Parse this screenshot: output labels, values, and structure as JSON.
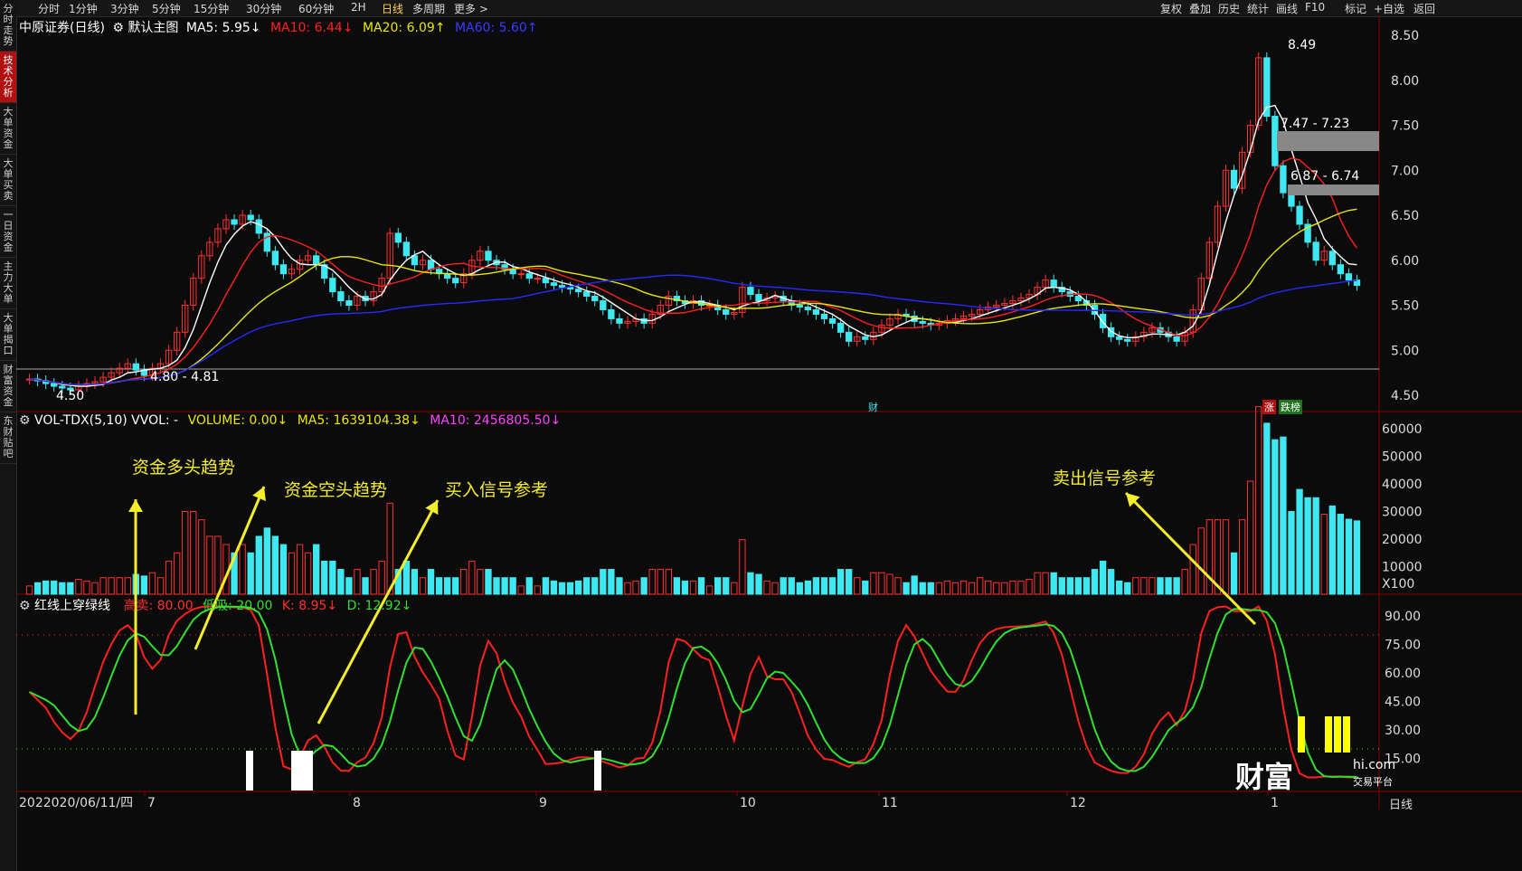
{
  "top_toolbar": {
    "periods": [
      "分时",
      "1分钟",
      "3分钟",
      "5分钟",
      "15分钟",
      "30分钟",
      "60分钟",
      "2H",
      "日线",
      "多周期",
      "更多 >"
    ],
    "active_period": "日线",
    "tools": [
      "复权",
      "叠加",
      "历史",
      "统计",
      "画线",
      "F10",
      "标记",
      "+自选",
      "返回"
    ]
  },
  "left_tabs": [
    "分时走势",
    "技术分析",
    "大单资金",
    "大单买卖",
    "一日资金",
    "主力大单",
    "大单揭口",
    "财富资金",
    "东财贴吧"
  ],
  "left_tab_active": 1,
  "price_panel": {
    "title": "中原证券(日线)",
    "main_chart_label": "默认主图",
    "ma5": "MA5: 5.95↓",
    "ma10": "MA10: 6.44↓",
    "ma20": "MA20: 6.09↑",
    "ma60": "MA60: 5.60↑",
    "colors": {
      "ma5": "#ffffff",
      "ma10": "#ff2020",
      "ma20": "#e8e800",
      "ma60": "#2828ff",
      "up": "#ff3030",
      "down": "#3ee8f0"
    },
    "y_ticks": [
      "8.50",
      "8.00",
      "7.50",
      "7.00",
      "6.50",
      "6.00",
      "5.50",
      "5.00",
      "4.50"
    ],
    "annotations": {
      "high": "8.49",
      "low": "4.50",
      "gap1": "7.47 - 7.23",
      "gap2": "6.87 - 6.74",
      "gap3": "4.80 - 4.81"
    },
    "markers": [
      "财",
      "涨",
      "跌榜"
    ]
  },
  "volume_panel": {
    "title": "VOL-TDX(5,10) VVOL: -",
    "volume": "VOLUME: 0.00↓",
    "ma5": "MA5: 1639104.38↓",
    "ma10": "MA10: 2456805.50↓",
    "y_ticks": [
      "60000",
      "50000",
      "40000",
      "30000",
      "20000",
      "10000",
      "X100"
    ]
  },
  "indicator_panel": {
    "title": "红线上穿绿线",
    "high_sell": "高卖: 80.00",
    "low_buy": "低吸: 20.00",
    "k": "K: 8.95↓",
    "d": "D: 12.92↓",
    "y_ticks": [
      "90.00",
      "75.00",
      "60.00",
      "45.00",
      "30.00",
      "15.00"
    ]
  },
  "x_axis": {
    "date_label": "2022020/06/11/四",
    "months": [
      "7",
      "8",
      "9",
      "10",
      "11",
      "12",
      "1"
    ],
    "period_label": "日线"
  },
  "callouts": [
    "资金多头趋势",
    "资金空头趋势",
    "买入信号参考",
    "卖出信号参考"
  ],
  "watermark": {
    "logo": "财富",
    "site": "hi.com",
    "sub": "交易平台"
  },
  "chart_data": {
    "type": "candlestick",
    "price_range": [
      4.45,
      8.55
    ],
    "closes": [
      4.68,
      4.66,
      4.63,
      4.6,
      4.58,
      4.56,
      4.6,
      4.63,
      4.65,
      4.7,
      4.75,
      4.8,
      4.85,
      4.78,
      4.72,
      4.8,
      4.85,
      5.0,
      5.2,
      5.5,
      5.8,
      6.05,
      6.2,
      6.35,
      6.45,
      6.4,
      6.5,
      6.45,
      6.3,
      6.1,
      5.95,
      5.85,
      5.9,
      6.0,
      6.05,
      5.95,
      5.8,
      5.65,
      5.55,
      5.5,
      5.6,
      5.55,
      5.65,
      5.8,
      6.3,
      6.2,
      6.05,
      5.95,
      6.0,
      5.9,
      5.85,
      5.8,
      5.75,
      5.85,
      6.0,
      6.1,
      6.0,
      5.95,
      5.9,
      5.85,
      5.85,
      5.8,
      5.8,
      5.75,
      5.72,
      5.7,
      5.68,
      5.65,
      5.6,
      5.55,
      5.45,
      5.35,
      5.3,
      5.32,
      5.35,
      5.3,
      5.4,
      5.5,
      5.6,
      5.55,
      5.52,
      5.55,
      5.5,
      5.5,
      5.45,
      5.4,
      5.42,
      5.7,
      5.62,
      5.55,
      5.58,
      5.6,
      5.55,
      5.5,
      5.48,
      5.45,
      5.4,
      5.35,
      5.3,
      5.2,
      5.1,
      5.15,
      5.12,
      5.2,
      5.28,
      5.35,
      5.4,
      5.38,
      5.32,
      5.3,
      5.28,
      5.3,
      5.33,
      5.35,
      5.38,
      5.4,
      5.45,
      5.48,
      5.5,
      5.52,
      5.55,
      5.58,
      5.62,
      5.7,
      5.78,
      5.7,
      5.65,
      5.6,
      5.55,
      5.5,
      5.4,
      5.25,
      5.15,
      5.12,
      5.1,
      5.15,
      5.2,
      5.25,
      5.2,
      5.15,
      5.1,
      5.2,
      5.45,
      5.8,
      6.2,
      6.6,
      7.0,
      6.8,
      7.2,
      7.5,
      8.25,
      7.6,
      7.05,
      6.75,
      6.6,
      6.4,
      6.2,
      6.0,
      6.1,
      5.95,
      5.85,
      5.78,
      5.72
    ],
    "ma5": [
      4.68,
      4.67,
      4.66,
      4.64,
      4.62,
      4.61,
      4.6,
      4.6,
      4.61,
      4.62,
      4.67,
      4.7,
      4.75,
      4.76,
      4.78,
      4.79,
      4.8,
      4.83,
      4.89,
      5.03,
      5.23,
      5.49,
      5.75,
      5.98,
      6.17,
      6.29,
      6.38,
      6.43,
      6.4,
      6.35,
      6.26,
      6.13,
      6.02,
      5.96,
      5.95,
      5.95,
      5.94,
      5.89,
      5.8,
      5.7,
      5.62,
      5.57,
      5.57,
      5.62,
      5.78,
      5.9,
      6.0,
      6.06,
      6.1,
      6.02,
      5.95,
      5.9,
      5.85,
      5.83,
      5.85,
      5.9,
      5.94,
      5.98,
      5.98,
      5.93,
      5.91,
      5.87,
      5.84,
      5.81,
      5.78,
      5.75,
      5.73,
      5.7,
      5.66,
      5.64,
      5.59,
      5.53,
      5.47,
      5.41,
      5.35,
      5.33,
      5.33,
      5.37,
      5.43,
      5.47,
      5.51,
      5.54,
      5.54,
      5.52,
      5.5,
      5.48,
      5.45,
      5.49,
      5.52,
      5.54,
      5.57,
      5.61,
      5.58,
      5.55,
      5.54,
      5.52,
      5.48,
      5.44,
      5.4,
      5.34,
      5.27,
      5.22,
      5.17,
      5.15,
      5.17,
      5.22,
      5.27,
      5.31,
      5.35,
      5.35,
      5.34,
      5.32,
      5.31,
      5.31,
      5.33,
      5.35,
      5.38,
      5.41,
      5.44,
      5.47,
      5.5,
      5.53,
      5.57,
      5.62,
      5.69,
      5.7,
      5.69,
      5.67,
      5.62,
      5.54,
      5.44,
      5.31,
      5.21,
      5.16,
      5.14,
      5.14,
      5.16,
      5.18,
      5.18,
      5.17,
      5.17,
      5.2,
      5.27,
      5.44,
      5.73,
      6.09,
      6.43,
      6.72,
      6.94,
      7.22,
      7.55,
      7.7,
      7.72,
      7.55,
      7.23,
      6.94,
      6.64,
      6.46,
      6.24,
      6.13,
      6.04,
      5.96,
      5.95
    ]
  }
}
